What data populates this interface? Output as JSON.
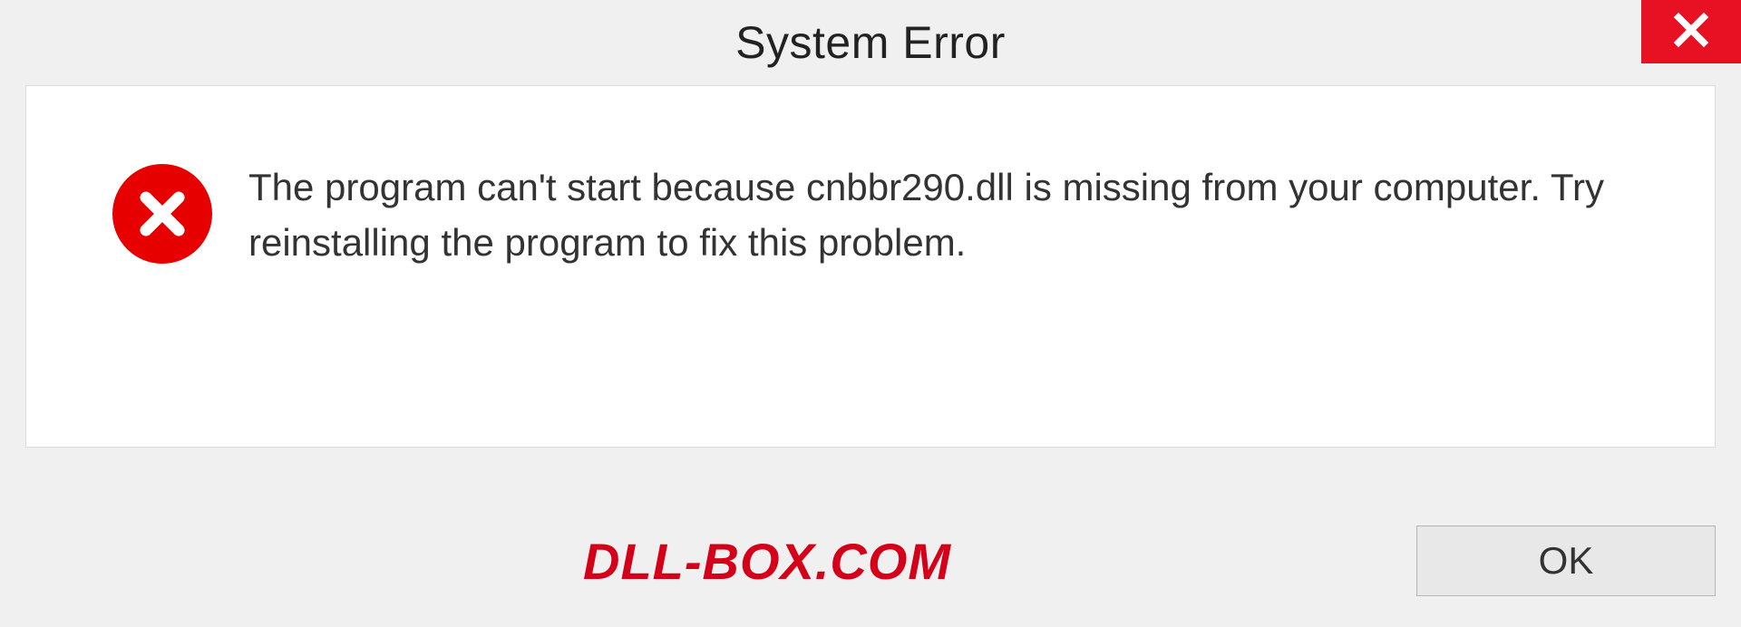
{
  "dialog": {
    "title": "System Error",
    "message": "The program can't start because cnbbr290.dll is missing from your computer. Try reinstalling the program to fix this problem.",
    "ok_label": "OK"
  },
  "watermark": "DLL-BOX.COM",
  "colors": {
    "close_bg": "#e81123",
    "error_icon_bg": "#e60000",
    "watermark": "#d4001a"
  }
}
